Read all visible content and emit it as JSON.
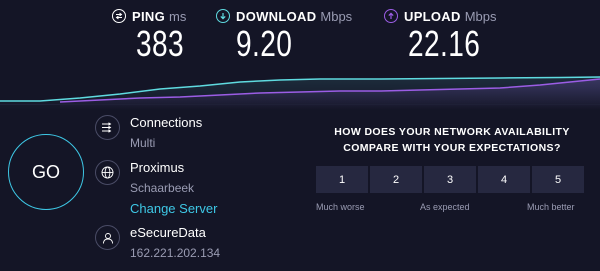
{
  "metrics": {
    "ping": {
      "label": "PING",
      "unit": "ms",
      "value": "383",
      "icon": "ping-icon"
    },
    "download": {
      "label": "DOWNLOAD",
      "unit": "Mbps",
      "value": "9.20",
      "icon": "download-arrow-icon"
    },
    "upload": {
      "label": "UPLOAD",
      "unit": "Mbps",
      "value": "22.16",
      "icon": "upload-arrow-icon"
    }
  },
  "colors": {
    "background": "#141526",
    "accent_cyan": "#3ec8e6",
    "download_line": "#5fdbe0",
    "upload_line": "#9b5de5",
    "muted_text": "#9a9cb3",
    "tile": "#262840"
  },
  "go_label": "GO",
  "connections": {
    "title": "Connections",
    "value": "Multi",
    "icon": "connections-icon"
  },
  "server": {
    "name": "Proximus",
    "location": "Schaarbeek",
    "change_label": "Change Server",
    "icon": "globe-icon"
  },
  "user": {
    "isp": "eSecureData",
    "ip": "162.221.202.134",
    "icon": "user-icon"
  },
  "survey": {
    "question_line1": "HOW DOES YOUR NETWORK AVAILABILITY",
    "question_line2": "COMPARE WITH YOUR EXPECTATIONS?",
    "options": [
      "1",
      "2",
      "3",
      "4",
      "5"
    ],
    "caption_low": "Much worse",
    "caption_mid": "As expected",
    "caption_high": "Much better"
  }
}
